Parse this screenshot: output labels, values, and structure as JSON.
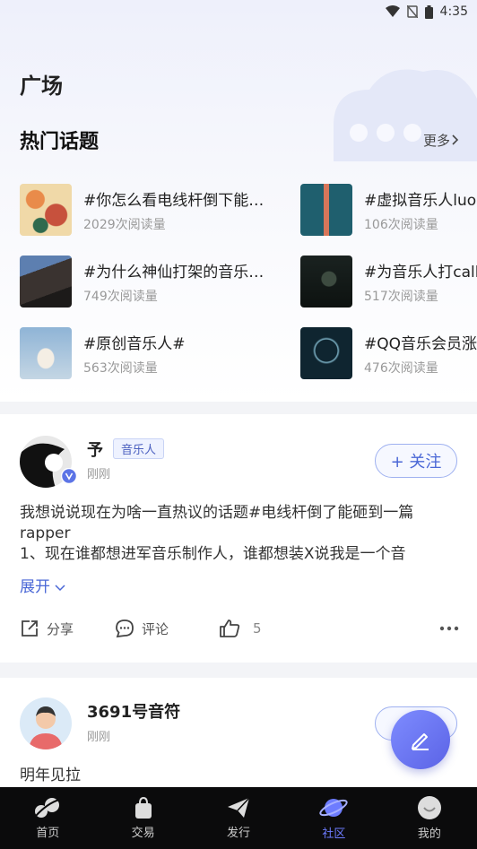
{
  "status": {
    "time": "4:35"
  },
  "page": {
    "title": "广场"
  },
  "topics": {
    "title": "热门话题",
    "more": "更多",
    "items": [
      {
        "name": "#你怎么看电线杆倒下能…",
        "reads": "2029次阅读量"
      },
      {
        "name": "#虚拟音乐人luo",
        "reads": "106次阅读量"
      },
      {
        "name": "#为什么神仙打架的音乐…",
        "reads": "749次阅读量"
      },
      {
        "name": "#为音乐人打call",
        "reads": "517次阅读量"
      },
      {
        "name": "#原创音乐人#",
        "reads": "563次阅读量"
      },
      {
        "name": "#QQ音乐会员涨",
        "reads": "476次阅读量"
      }
    ]
  },
  "posts": [
    {
      "author": "予",
      "badge": "音乐人",
      "time": "刚刚",
      "follow": "+ 关注",
      "text_line1": "我想说说现在为啥一直热议的话题#电线杆倒了能砸到一篇",
      "text_line2": "rapper",
      "text_line3": "1、现在谁都想进军音乐制作人，谁都想装X说我是一个音",
      "expand": "展开",
      "share": "分享",
      "comment": "评论",
      "likes": "5"
    },
    {
      "author": "3691号音符",
      "time": "刚刚",
      "text_line1": "明年见拉"
    }
  ],
  "nav": [
    {
      "label": "首页"
    },
    {
      "label": "交易"
    },
    {
      "label": "发行"
    },
    {
      "label": "社区"
    },
    {
      "label": "我的"
    }
  ],
  "colors": {
    "accent": "#4a67d6",
    "nav_active": "#6d7cff",
    "nav_bg": "#0b0b0c"
  }
}
